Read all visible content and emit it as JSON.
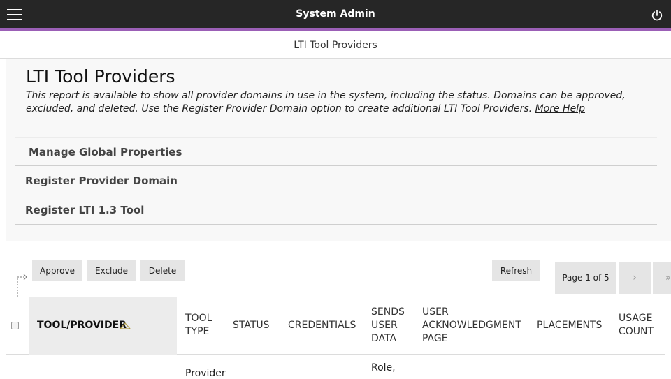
{
  "header": {
    "app_title": "System Admin",
    "menu_icon": "hamburger-menu-icon",
    "power_icon": "power-icon"
  },
  "breadcrumb": {
    "current": "LTI Tool Providers"
  },
  "page": {
    "title": "LTI Tool Providers",
    "description": "This report is available to show all provider domains in use in the system, including the status. Domains can be approved, excluded, and deleted. Use the Register Provider Domain option to create additional LTI Tool Providers.",
    "more_help": "More Help"
  },
  "actions": [
    {
      "label": "Manage Global Properties"
    },
    {
      "label": "Register Provider Domain"
    },
    {
      "label": "Register LTI 1.3 Tool"
    }
  ],
  "toolbar": {
    "approve": "Approve",
    "exclude": "Exclude",
    "delete": "Delete",
    "refresh": "Refresh"
  },
  "pager": {
    "label": "Page 1 of 5",
    "next_icon": "chevron-right-icon",
    "last_icon": "double-chevron-right-icon"
  },
  "table": {
    "columns": [
      {
        "label": "TOOL/PROVIDER",
        "sorted": "ascending"
      },
      {
        "label": "TOOL TYPE"
      },
      {
        "label": "STATUS"
      },
      {
        "label": "CREDENTIALS"
      },
      {
        "label": "SENDS USER DATA"
      },
      {
        "label": "USER ACKNOWLEDGMENT PAGE"
      },
      {
        "label": "PLACEMENTS"
      },
      {
        "label": "USAGE COUNT"
      }
    ],
    "rows": [
      {
        "tool_type": "Provider",
        "sends_user_data": "Role,"
      }
    ]
  },
  "colors": {
    "topbar": "#262626",
    "accent": "#9b5fb6",
    "button_bg": "#e5e5e5",
    "panel_bg": "#f8f8f8"
  }
}
